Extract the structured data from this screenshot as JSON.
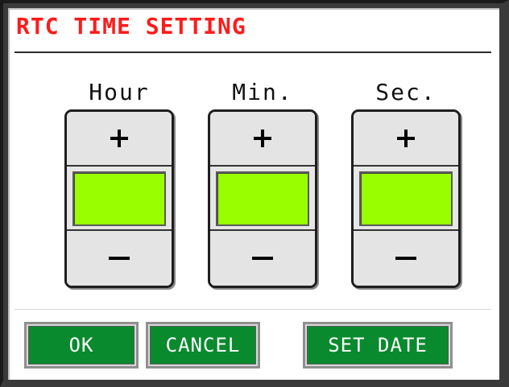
{
  "title": "RTC TIME SETTING",
  "columns": [
    {
      "label": "Hour",
      "value": ""
    },
    {
      "label": "Min.",
      "value": ""
    },
    {
      "label": "Sec.",
      "value": ""
    }
  ],
  "buttons": {
    "ok": "OK",
    "cancel": "CANCEL",
    "set_date": "SET DATE"
  },
  "colors": {
    "title": "#ff1a1a",
    "value_bg": "#99ff00",
    "button_bg": "#0a8a2e"
  },
  "icons": {
    "increment": "plus-icon",
    "decrement": "minus-icon"
  }
}
